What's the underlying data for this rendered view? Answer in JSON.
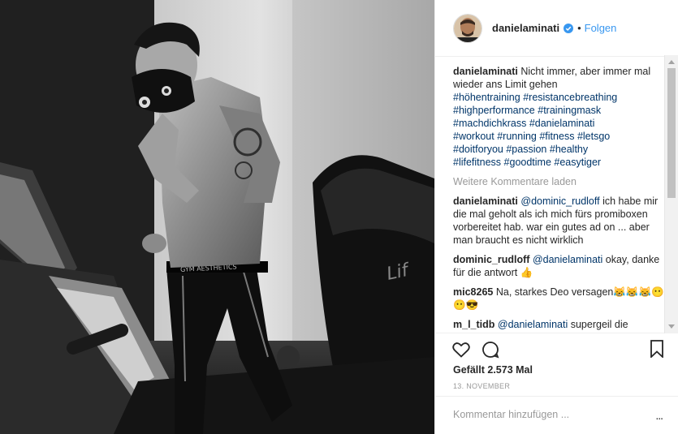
{
  "header": {
    "username": "danielaminati",
    "separator": "•",
    "follow_label": "Folgen"
  },
  "caption": {
    "username": "danielaminati",
    "text": "Nicht immer, aber immer mal wieder ans Limit gehen",
    "hashtags": [
      "#höhentraining",
      "#resistancebreathing",
      "#highperformance",
      "#trainingmask",
      "#machdichkrass",
      "#danielaminati",
      "#workout",
      "#running",
      "#fitness",
      "#letsgo",
      "#doitforyou",
      "#passion",
      "#healthy",
      "#lifefitness",
      "#goodtime",
      "#easytiger"
    ]
  },
  "load_more_label": "Weitere Kommentare laden",
  "comments": [
    {
      "username": "danielaminati",
      "mention": "@dominic_rudloff",
      "text": "ich habe mir die mal geholt als ich mich fürs promiboxen vorbereitet hab. war ein gutes ad on ... aber man braucht es nicht wirklich"
    },
    {
      "username": "dominic_rudloff",
      "mention": "@danielaminati",
      "text": "okay, danke für die antwort 👍"
    },
    {
      "username": "mic8265",
      "mention": "",
      "text": "Na, starkes Deo versagen😹😹😹😶😶😎"
    },
    {
      "username": "m_l_tidb",
      "mention": "@danielaminati",
      "text": "supergeil die"
    }
  ],
  "likes_label": "Gefällt 2.573 Mal",
  "date_label": "13. NOVEMBER",
  "comment_input": {
    "placeholder": "Kommentar hinzufügen ...",
    "value": ""
  },
  "more_label": "...",
  "colors": {
    "accent": "#3897f0",
    "hashtag": "#003569",
    "muted": "#999999",
    "border": "#efefef"
  },
  "icons": [
    "verified-icon",
    "heart-icon",
    "comment-icon",
    "bookmark-icon",
    "more-options-icon"
  ]
}
